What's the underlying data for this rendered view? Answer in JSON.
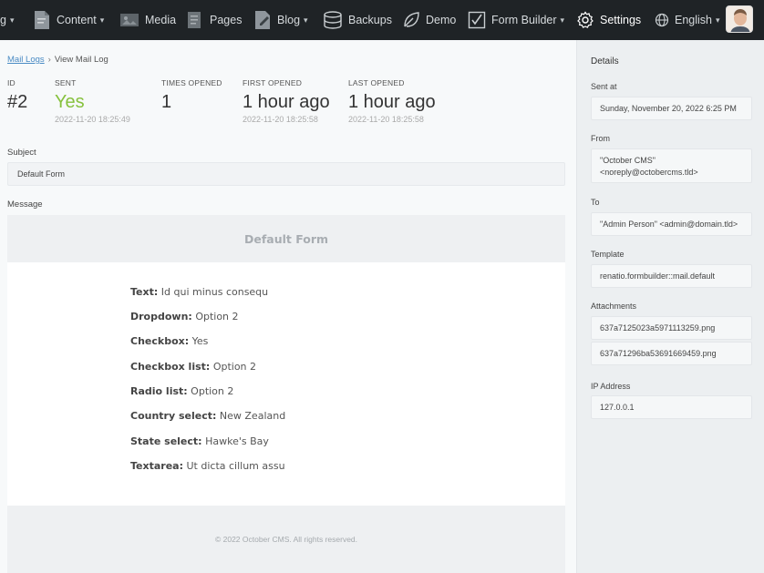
{
  "nav": {
    "items": [
      {
        "label": "g",
        "has_chevron": true
      },
      {
        "label": "Content",
        "icon": "content-icon",
        "has_chevron": true
      },
      {
        "label": "Media",
        "icon": "media-icon"
      },
      {
        "label": "Pages",
        "icon": "pages-icon"
      },
      {
        "label": "Blog",
        "icon": "blog-icon",
        "has_chevron": true
      },
      {
        "label": "Backups",
        "icon": "database-icon"
      },
      {
        "label": "Demo",
        "icon": "leaf-icon"
      },
      {
        "label": "Form Builder",
        "icon": "checkbox-icon",
        "has_chevron": true
      },
      {
        "label": "Settings",
        "icon": "gear-icon",
        "active": true
      },
      {
        "label": "English",
        "icon": "globe-icon",
        "has_chevron": true
      }
    ],
    "avatar": "user-avatar"
  },
  "breadcrumb": {
    "parent": "Mail Logs",
    "current": "View Mail Log"
  },
  "stats": {
    "id": {
      "heading": "ID",
      "value": "#2"
    },
    "sent": {
      "heading": "SENT",
      "value": "Yes",
      "date": "2022-11-20 18:25:49"
    },
    "times_opened": {
      "heading": "TIMES OPENED",
      "value": "1"
    },
    "first_opened": {
      "heading": "FIRST OPENED",
      "value": "1 hour ago",
      "date": "2022-11-20 18:25:58"
    },
    "last_opened": {
      "heading": "LAST OPENED",
      "value": "1 hour ago",
      "date": "2022-11-20 18:25:58"
    }
  },
  "subject": {
    "label": "Subject",
    "value": "Default Form"
  },
  "message": {
    "label": "Message",
    "header": "Default Form",
    "rows": [
      {
        "key": "Text:",
        "value": "Id qui minus consequ"
      },
      {
        "key": "Dropdown:",
        "value": "Option 2"
      },
      {
        "key": "Checkbox:",
        "value": "Yes"
      },
      {
        "key": "Checkbox list:",
        "value": "Option 2"
      },
      {
        "key": "Radio list:",
        "value": "Option 2"
      },
      {
        "key": "Country select:",
        "value": "New Zealand"
      },
      {
        "key": "State select:",
        "value": "Hawke's Bay"
      },
      {
        "key": "Textarea:",
        "value": "Ut dicta cillum assu"
      }
    ],
    "footer": "© 2022 October CMS. All rights reserved."
  },
  "details": {
    "title": "Details",
    "sent_at": {
      "label": "Sent at",
      "value": "Sunday, November 20, 2022 6:25 PM"
    },
    "from": {
      "label": "From",
      "line1": "\"October CMS\"",
      "line2": "<noreply@octobercms.tld>"
    },
    "to": {
      "label": "To",
      "value": "\"Admin Person\" <admin@domain.tld>"
    },
    "template": {
      "label": "Template",
      "value": "renatio.formbuilder::mail.default"
    },
    "attachments": {
      "label": "Attachments",
      "files": [
        "637a7125023a5971113259.png",
        "637a71296ba53691669459.png"
      ]
    },
    "ip": {
      "label": "IP Address",
      "value": "127.0.0.1"
    }
  },
  "colors": {
    "topbar": "#1f2326",
    "sent_yes": "#86c13d",
    "link": "#4a8bc4"
  }
}
